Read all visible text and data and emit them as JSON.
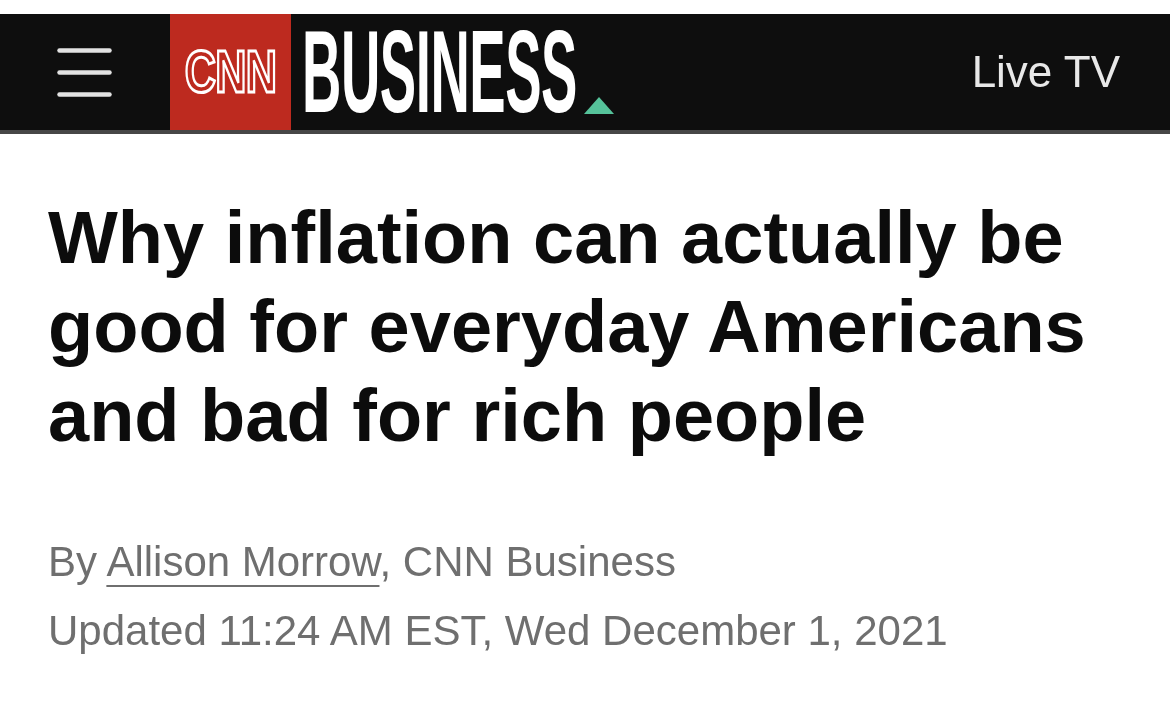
{
  "header": {
    "logo": {
      "network": "CNN",
      "section": "BUSINESS"
    },
    "live_tv_link": "Live TV"
  },
  "article": {
    "headline": "Why inflation can actually be good for everyday Americans and bad for rich people",
    "byline": {
      "prefix": "By",
      "author": "Allison Morrow",
      "suffix": ", CNN Business"
    },
    "timestamp": "Updated 11:24 AM EST, Wed December 1, 2021"
  }
}
